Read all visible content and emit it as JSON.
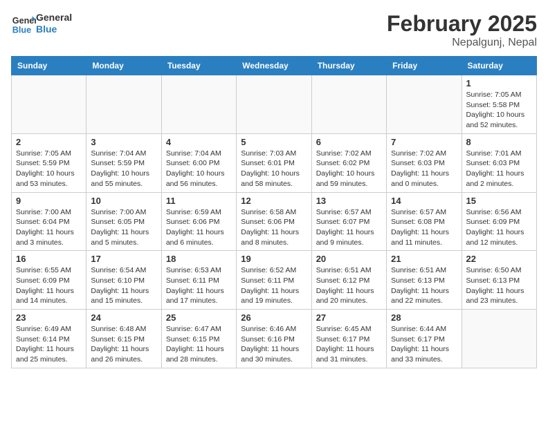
{
  "header": {
    "logo_line1": "General",
    "logo_line2": "Blue",
    "month": "February 2025",
    "location": "Nepalgunj, Nepal"
  },
  "weekdays": [
    "Sunday",
    "Monday",
    "Tuesday",
    "Wednesday",
    "Thursday",
    "Friday",
    "Saturday"
  ],
  "weeks": [
    [
      {
        "day": "",
        "info": ""
      },
      {
        "day": "",
        "info": ""
      },
      {
        "day": "",
        "info": ""
      },
      {
        "day": "",
        "info": ""
      },
      {
        "day": "",
        "info": ""
      },
      {
        "day": "",
        "info": ""
      },
      {
        "day": "1",
        "info": "Sunrise: 7:05 AM\nSunset: 5:58 PM\nDaylight: 10 hours\nand 52 minutes."
      }
    ],
    [
      {
        "day": "2",
        "info": "Sunrise: 7:05 AM\nSunset: 5:59 PM\nDaylight: 10 hours\nand 53 minutes."
      },
      {
        "day": "3",
        "info": "Sunrise: 7:04 AM\nSunset: 5:59 PM\nDaylight: 10 hours\nand 55 minutes."
      },
      {
        "day": "4",
        "info": "Sunrise: 7:04 AM\nSunset: 6:00 PM\nDaylight: 10 hours\nand 56 minutes."
      },
      {
        "day": "5",
        "info": "Sunrise: 7:03 AM\nSunset: 6:01 PM\nDaylight: 10 hours\nand 58 minutes."
      },
      {
        "day": "6",
        "info": "Sunrise: 7:02 AM\nSunset: 6:02 PM\nDaylight: 10 hours\nand 59 minutes."
      },
      {
        "day": "7",
        "info": "Sunrise: 7:02 AM\nSunset: 6:03 PM\nDaylight: 11 hours\nand 0 minutes."
      },
      {
        "day": "8",
        "info": "Sunrise: 7:01 AM\nSunset: 6:03 PM\nDaylight: 11 hours\nand 2 minutes."
      }
    ],
    [
      {
        "day": "9",
        "info": "Sunrise: 7:00 AM\nSunset: 6:04 PM\nDaylight: 11 hours\nand 3 minutes."
      },
      {
        "day": "10",
        "info": "Sunrise: 7:00 AM\nSunset: 6:05 PM\nDaylight: 11 hours\nand 5 minutes."
      },
      {
        "day": "11",
        "info": "Sunrise: 6:59 AM\nSunset: 6:06 PM\nDaylight: 11 hours\nand 6 minutes."
      },
      {
        "day": "12",
        "info": "Sunrise: 6:58 AM\nSunset: 6:06 PM\nDaylight: 11 hours\nand 8 minutes."
      },
      {
        "day": "13",
        "info": "Sunrise: 6:57 AM\nSunset: 6:07 PM\nDaylight: 11 hours\nand 9 minutes."
      },
      {
        "day": "14",
        "info": "Sunrise: 6:57 AM\nSunset: 6:08 PM\nDaylight: 11 hours\nand 11 minutes."
      },
      {
        "day": "15",
        "info": "Sunrise: 6:56 AM\nSunset: 6:09 PM\nDaylight: 11 hours\nand 12 minutes."
      }
    ],
    [
      {
        "day": "16",
        "info": "Sunrise: 6:55 AM\nSunset: 6:09 PM\nDaylight: 11 hours\nand 14 minutes."
      },
      {
        "day": "17",
        "info": "Sunrise: 6:54 AM\nSunset: 6:10 PM\nDaylight: 11 hours\nand 15 minutes."
      },
      {
        "day": "18",
        "info": "Sunrise: 6:53 AM\nSunset: 6:11 PM\nDaylight: 11 hours\nand 17 minutes."
      },
      {
        "day": "19",
        "info": "Sunrise: 6:52 AM\nSunset: 6:11 PM\nDaylight: 11 hours\nand 19 minutes."
      },
      {
        "day": "20",
        "info": "Sunrise: 6:51 AM\nSunset: 6:12 PM\nDaylight: 11 hours\nand 20 minutes."
      },
      {
        "day": "21",
        "info": "Sunrise: 6:51 AM\nSunset: 6:13 PM\nDaylight: 11 hours\nand 22 minutes."
      },
      {
        "day": "22",
        "info": "Sunrise: 6:50 AM\nSunset: 6:13 PM\nDaylight: 11 hours\nand 23 minutes."
      }
    ],
    [
      {
        "day": "23",
        "info": "Sunrise: 6:49 AM\nSunset: 6:14 PM\nDaylight: 11 hours\nand 25 minutes."
      },
      {
        "day": "24",
        "info": "Sunrise: 6:48 AM\nSunset: 6:15 PM\nDaylight: 11 hours\nand 26 minutes."
      },
      {
        "day": "25",
        "info": "Sunrise: 6:47 AM\nSunset: 6:15 PM\nDaylight: 11 hours\nand 28 minutes."
      },
      {
        "day": "26",
        "info": "Sunrise: 6:46 AM\nSunset: 6:16 PM\nDaylight: 11 hours\nand 30 minutes."
      },
      {
        "day": "27",
        "info": "Sunrise: 6:45 AM\nSunset: 6:17 PM\nDaylight: 11 hours\nand 31 minutes."
      },
      {
        "day": "28",
        "info": "Sunrise: 6:44 AM\nSunset: 6:17 PM\nDaylight: 11 hours\nand 33 minutes."
      },
      {
        "day": "",
        "info": ""
      }
    ]
  ]
}
